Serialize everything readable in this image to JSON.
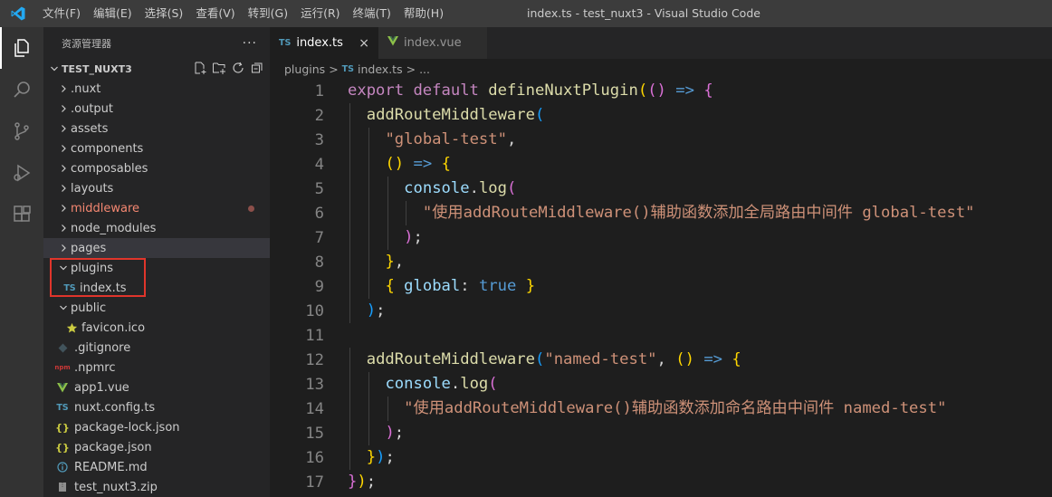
{
  "window": {
    "title": "index.ts - test_nuxt3 - Visual Studio Code",
    "menu": [
      "文件(F)",
      "编辑(E)",
      "选择(S)",
      "查看(V)",
      "转到(G)",
      "运行(R)",
      "终端(T)",
      "帮助(H)"
    ]
  },
  "activity_bar": {
    "icons": [
      "files-icon",
      "search-icon",
      "source-control-icon",
      "run-debug-icon",
      "extensions-icon"
    ]
  },
  "explorer": {
    "header": "资源管理器",
    "more": "···",
    "project": "TEST_NUXT3",
    "items": [
      {
        "label": ".nuxt",
        "type": "folder"
      },
      {
        "label": ".output",
        "type": "folder"
      },
      {
        "label": "assets",
        "type": "folder"
      },
      {
        "label": "components",
        "type": "folder"
      },
      {
        "label": "composables",
        "type": "folder"
      },
      {
        "label": "layouts",
        "type": "folder"
      },
      {
        "label": "middleware",
        "type": "folder",
        "modified": true
      },
      {
        "label": "node_modules",
        "type": "folder"
      },
      {
        "label": "pages",
        "type": "folder"
      },
      {
        "label": "plugins",
        "type": "folder-open"
      },
      {
        "label": "index.ts",
        "type": "ts"
      },
      {
        "label": "public",
        "type": "folder-open"
      },
      {
        "label": "favicon.ico",
        "type": "star"
      },
      {
        "label": ".gitignore",
        "type": "git"
      },
      {
        "label": ".npmrc",
        "type": "npm"
      },
      {
        "label": "app1.vue",
        "type": "vue"
      },
      {
        "label": "nuxt.config.ts",
        "type": "ts"
      },
      {
        "label": "package-lock.json",
        "type": "json"
      },
      {
        "label": "package.json",
        "type": "json"
      },
      {
        "label": "README.md",
        "type": "info"
      },
      {
        "label": "test_nuxt3.zip",
        "type": "zip"
      }
    ],
    "badges": {
      "ts": "TS",
      "json": "{}",
      "npm": "npm"
    }
  },
  "tabs": [
    {
      "label": "index.ts",
      "badge": "TS",
      "active": true,
      "close": "×"
    },
    {
      "label": "index.vue",
      "badge": "V",
      "active": false
    }
  ],
  "breadcrumb": {
    "folder": "plugins",
    "sep": ">",
    "badge": "TS",
    "file": "index.ts",
    "sep2": ">",
    "tail": "..."
  },
  "code": {
    "line_numbers": [
      "1",
      "2",
      "3",
      "4",
      "5",
      "6",
      "7",
      "8",
      "9",
      "10",
      "11",
      "12",
      "13",
      "14",
      "15",
      "16",
      "17"
    ],
    "lines": [
      "export default defineNuxtPlugin(() => {",
      "  addRouteMiddleware(",
      "    \"global-test\",",
      "    () => {",
      "      console.log(",
      "        \"使用addRouteMiddleware()辅助函数添加全局路由中间件 global-test\"",
      "      );",
      "    },",
      "    { global: true }",
      "  );",
      "",
      "  addRouteMiddleware(\"named-test\", () => {",
      "    console.log(",
      "      \"使用addRouteMiddleware()辅助函数添加命名路由中间件 named-test\"",
      "    );",
      "  });",
      "});"
    ]
  },
  "colors": {
    "keyword": "#c586c0",
    "function": "#dcdcaa",
    "string": "#ce9178",
    "variable": "#9cdcfe",
    "boolean": "#569cd6",
    "bracket1": "#ffd700",
    "bracket2": "#da70d6",
    "bracket3": "#179fff",
    "highlight_box": "#e0352b"
  }
}
